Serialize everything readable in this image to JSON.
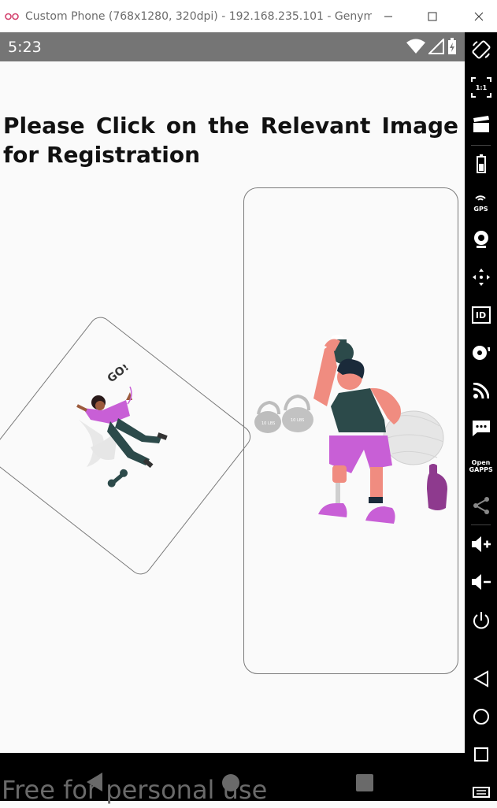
{
  "window": {
    "title": "Custom Phone (768x1280, 320dpi) - 192.168.235.101 - Genymot..."
  },
  "status_bar": {
    "time": "5:23"
  },
  "screen": {
    "heading": "Please Click on the Relevant Image for Registration"
  },
  "illustrations": {
    "left_card": {
      "icon": "person-lying-exercise-illustration",
      "text": "GO!"
    },
    "right_card": {
      "icon": "person-kettlebell-illustration",
      "weight_labels": [
        "10 LBS",
        "10 LBS"
      ]
    }
  },
  "nav_bar": {
    "buttons": [
      "back",
      "home",
      "recents"
    ]
  },
  "watermark": "Free for personal use",
  "sidebar": {
    "items": [
      "rotate",
      "pixel-perfect",
      "capture",
      "battery",
      "GPS",
      "webcam",
      "remote-control",
      "ID",
      "disk-io",
      "network",
      "sms",
      "Open GAPPS",
      "share",
      "volume-up",
      "volume-down",
      "power",
      "back",
      "home",
      "recents",
      "menu"
    ],
    "gps_label": "GPS",
    "id_label": "ID",
    "pixel_label": "1:1",
    "open_gapps_label": "Open GAPPS"
  },
  "colors": {
    "status_bar": "#757575",
    "accent_purple": "#c85fd6",
    "card_border": "#7a7a7a"
  }
}
